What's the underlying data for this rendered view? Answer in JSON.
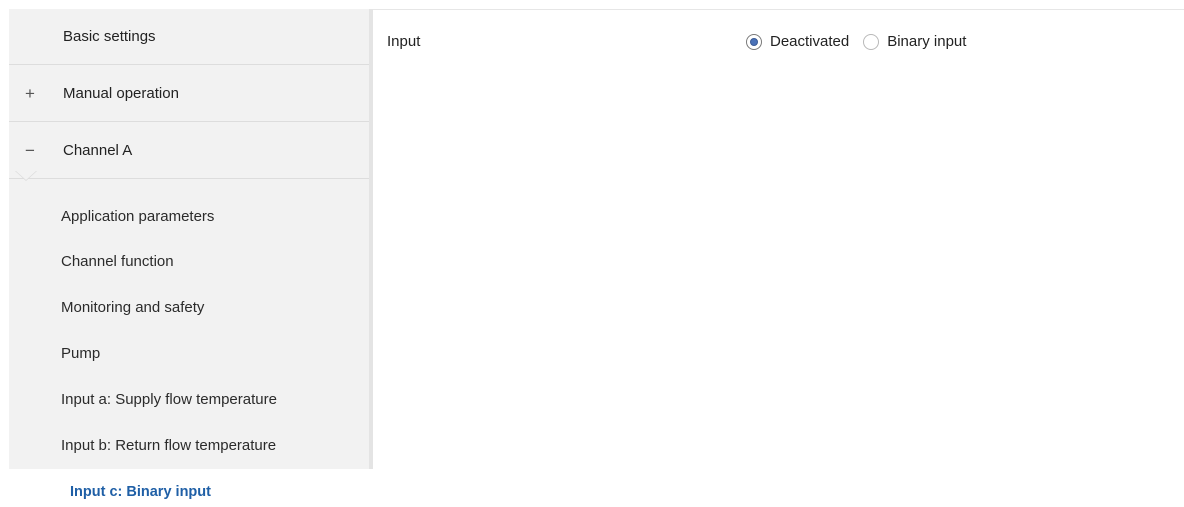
{
  "sidebar": {
    "basic_settings": "Basic settings",
    "manual_operation": {
      "toggle": "+",
      "label": "Manual operation"
    },
    "channel_a": {
      "toggle": "−",
      "label": "Channel A"
    },
    "sub_items": [
      "Application parameters",
      "Channel function",
      "Monitoring and safety",
      "Pump",
      "Input a: Supply flow temperature",
      "Input b: Return flow temperature"
    ],
    "active_item": "Input c: Binary input"
  },
  "main": {
    "param_label": "Input",
    "options": [
      {
        "label": "Deactivated",
        "checked": true
      },
      {
        "label": "Binary input",
        "checked": false
      }
    ]
  },
  "colors": {
    "accent": "#1f5fa6",
    "sidebar_bg": "#f2f2f2",
    "radio_dot": "#4a72b8"
  }
}
